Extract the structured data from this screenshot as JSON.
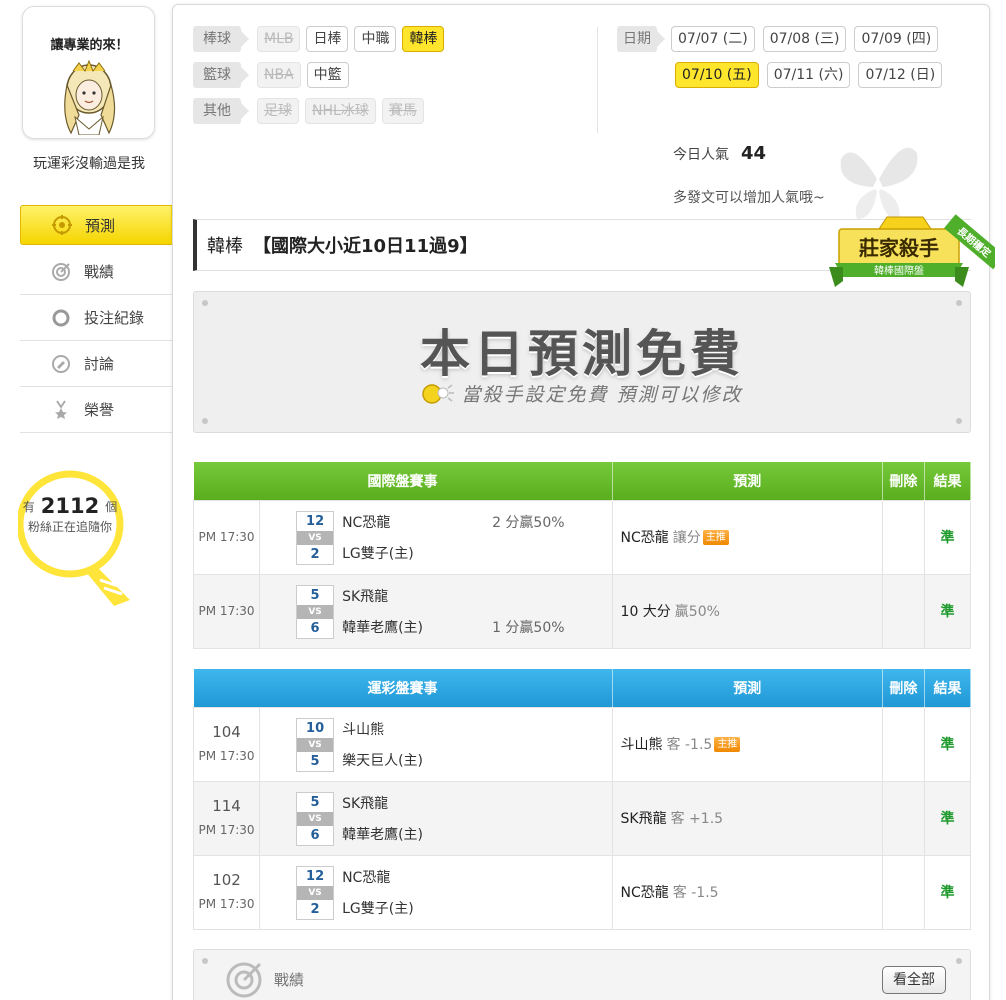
{
  "sidebar": {
    "avatar_caption": "讓專業的來！",
    "slogan": "玩運彩沒輸過是我",
    "nav": [
      {
        "label": "預測",
        "icon": "target-icon",
        "active": true
      },
      {
        "label": "戰績",
        "icon": "record-icon",
        "active": false
      },
      {
        "label": "投注紀錄",
        "icon": "circle-icon",
        "active": false
      },
      {
        "label": "討論",
        "icon": "discussion-icon",
        "active": false
      },
      {
        "label": "榮譽",
        "icon": "medal-icon",
        "active": false
      }
    ],
    "fans_prefix": "有",
    "fans_count": "2112",
    "fans_unit": "個",
    "fans_suffix": "粉絲正在追隨你"
  },
  "filters": {
    "baseball": {
      "label": "棒球",
      "items": [
        {
          "label": "MLB",
          "state": "disabled"
        },
        {
          "label": "日棒",
          "state": "normal"
        },
        {
          "label": "中職",
          "state": "normal"
        },
        {
          "label": "韓棒",
          "state": "active"
        }
      ]
    },
    "basketball": {
      "label": "籃球",
      "items": [
        {
          "label": "NBA",
          "state": "disabled"
        },
        {
          "label": "中籃",
          "state": "normal"
        }
      ]
    },
    "other": {
      "label": "其他",
      "items": [
        {
          "label": "足球",
          "state": "disabled"
        },
        {
          "label": "NHL冰球",
          "state": "disabled"
        },
        {
          "label": "賽馬",
          "state": "disabled"
        }
      ]
    }
  },
  "dates": {
    "label": "日期",
    "row1": [
      "07/07 (二)",
      "07/08 (三)",
      "07/09 (四)"
    ],
    "row2": [
      "07/10 (五)",
      "07/11 (六)",
      "07/12 (日)"
    ],
    "active": "07/10 (五)"
  },
  "popularity": {
    "label": "今日人氣",
    "value": "44",
    "hint": "多發文可以增加人氣哦~"
  },
  "title": {
    "category": "韓棒",
    "record": "【國際大小近10日11過9】"
  },
  "badge": {
    "main": "莊家殺手",
    "sub": "韓棒國際盤",
    "ribbon": "長期穩定"
  },
  "free_banner": {
    "title": "本日預測免費",
    "subtitle": "當殺手設定免費  預測可以修改"
  },
  "intl_table": {
    "headers": [
      "國際盤賽事",
      "預測",
      "刪除",
      "結果"
    ],
    "rows": [
      {
        "no": "",
        "time": "PM 17:30",
        "score1": "12",
        "score2": "2",
        "vs": "VS",
        "team1": "NC恐龍",
        "team2": "LG雙子(主)",
        "handicap": "2 分贏50%",
        "handicap_row": 1,
        "pred": "NC恐龍",
        "pred_detail": "讓分",
        "main_tag": "主推",
        "result": "準"
      },
      {
        "no": "",
        "time": "PM 17:30",
        "score1": "5",
        "score2": "6",
        "vs": "VS",
        "team1": "SK飛龍",
        "team2": "韓華老鷹(主)",
        "handicap": "1 分贏50%",
        "handicap_row": 2,
        "pred": "10 大分",
        "pred_detail": "贏50%",
        "main_tag": "",
        "result": "準"
      }
    ]
  },
  "sports_table": {
    "headers": [
      "運彩盤賽事",
      "預測",
      "刪除",
      "結果"
    ],
    "rows": [
      {
        "no": "104",
        "time": "PM 17:30",
        "score1": "10",
        "score2": "5",
        "vs": "VS",
        "team1": "斗山熊",
        "team2": "樂天巨人(主)",
        "handicap": "",
        "pred": "斗山熊",
        "pred_detail": "客 -1.5",
        "main_tag": "主推",
        "result": "準"
      },
      {
        "no": "114",
        "time": "PM 17:30",
        "score1": "5",
        "score2": "6",
        "vs": "VS",
        "team1": "SK飛龍",
        "team2": "韓華老鷹(主)",
        "handicap": "",
        "pred": "SK飛龍",
        "pred_detail": "客 +1.5",
        "main_tag": "",
        "result": "準"
      },
      {
        "no": "102",
        "time": "PM 17:30",
        "score1": "12",
        "score2": "2",
        "vs": "VS",
        "team1": "NC恐龍",
        "team2": "LG雙子(主)",
        "handicap": "",
        "pred": "NC恐龍",
        "pred_detail": "客 -1.5",
        "main_tag": "",
        "result": "準"
      }
    ]
  },
  "record_section": {
    "label": "戰績",
    "see_all": "看全部"
  },
  "colors": {
    "accent_yellow": "#ffe62c",
    "green_header": "#5aae1e",
    "blue_header": "#1f98d6",
    "result_green": "#1e9a2c"
  }
}
